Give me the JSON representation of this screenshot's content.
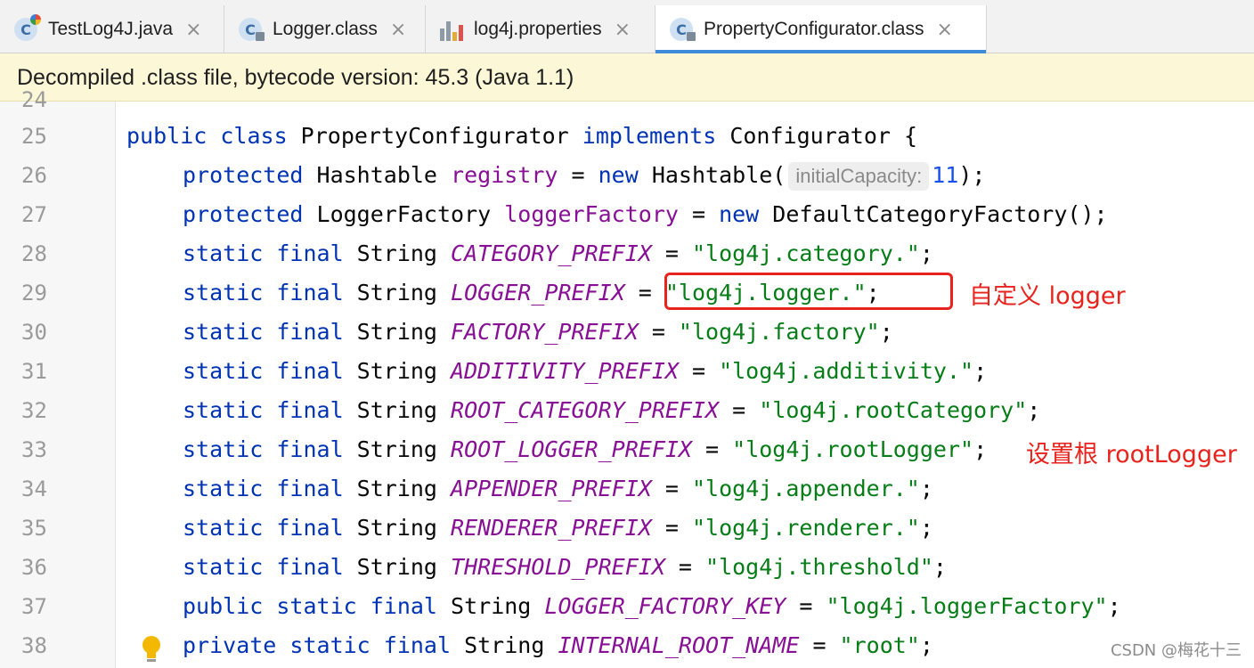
{
  "tabs": [
    {
      "label": "TestLog4J.java",
      "icon": "java-class-run-icon",
      "active": false
    },
    {
      "label": "Logger.class",
      "icon": "class-file-icon",
      "active": false
    },
    {
      "label": "log4j.properties",
      "icon": "properties-file-icon",
      "active": false
    },
    {
      "label": "PropertyConfigurator.class",
      "icon": "class-file-icon",
      "active": true
    }
  ],
  "close_glyph": "×",
  "banner": {
    "text": "Decompiled .class file, bytecode version: 45.3 (Java 1.1)"
  },
  "editor": {
    "line_numbers": [
      "25",
      "26",
      "27",
      "28",
      "29",
      "30",
      "31",
      "32",
      "33",
      "34",
      "35",
      "36",
      "37",
      "38"
    ],
    "hint_label": "initialCapacity:",
    "lines": [
      [
        {
          "t": "public class",
          "c": "kw"
        },
        {
          "t": " PropertyConfigurator "
        },
        {
          "t": "implements",
          "c": "kw"
        },
        {
          "t": " Configurator {"
        }
      ],
      [
        {
          "t": "protected",
          "c": "kw"
        },
        {
          "t": " Hashtable "
        },
        {
          "t": "registry",
          "c": "fld"
        },
        {
          "t": " = "
        },
        {
          "t": "new",
          "c": "kw"
        },
        {
          "t": " Hashtable("
        },
        {
          "t": "initialCapacity:",
          "c": "hint"
        },
        {
          "t": "11",
          "c": "num"
        },
        {
          "t": ");"
        }
      ],
      [
        {
          "t": "protected",
          "c": "kw"
        },
        {
          "t": " LoggerFactory "
        },
        {
          "t": "loggerFactory",
          "c": "fld"
        },
        {
          "t": " = "
        },
        {
          "t": "new",
          "c": "kw"
        },
        {
          "t": " DefaultCategoryFactory();"
        }
      ],
      [
        {
          "t": "static final",
          "c": "kw"
        },
        {
          "t": " String "
        },
        {
          "t": "CATEGORY_PREFIX",
          "c": "cst"
        },
        {
          "t": " = "
        },
        {
          "t": "\"log4j.category.\"",
          "c": "str"
        },
        {
          "t": ";"
        }
      ],
      [
        {
          "t": "static final",
          "c": "kw"
        },
        {
          "t": " String "
        },
        {
          "t": "LOGGER_PREFIX",
          "c": "cst"
        },
        {
          "t": " = "
        },
        {
          "t": "\"log4j.logger.\"",
          "c": "str"
        },
        {
          "t": ";"
        }
      ],
      [
        {
          "t": "static final",
          "c": "kw"
        },
        {
          "t": " String "
        },
        {
          "t": "FACTORY_PREFIX",
          "c": "cst"
        },
        {
          "t": " = "
        },
        {
          "t": "\"log4j.factory\"",
          "c": "str"
        },
        {
          "t": ";"
        }
      ],
      [
        {
          "t": "static final",
          "c": "kw"
        },
        {
          "t": " String "
        },
        {
          "t": "ADDITIVITY_PREFIX",
          "c": "cst"
        },
        {
          "t": " = "
        },
        {
          "t": "\"log4j.additivity.\"",
          "c": "str"
        },
        {
          "t": ";"
        }
      ],
      [
        {
          "t": "static final",
          "c": "kw"
        },
        {
          "t": " String "
        },
        {
          "t": "ROOT_CATEGORY_PREFIX",
          "c": "cst"
        },
        {
          "t": " = "
        },
        {
          "t": "\"log4j.rootCategory\"",
          "c": "str"
        },
        {
          "t": ";"
        }
      ],
      [
        {
          "t": "static final",
          "c": "kw"
        },
        {
          "t": " String "
        },
        {
          "t": "ROOT_LOGGER_PREFIX",
          "c": "cst"
        },
        {
          "t": " = "
        },
        {
          "t": "\"log4j.rootLogger\"",
          "c": "str"
        },
        {
          "t": ";"
        }
      ],
      [
        {
          "t": "static final",
          "c": "kw"
        },
        {
          "t": " String "
        },
        {
          "t": "APPENDER_PREFIX",
          "c": "cst"
        },
        {
          "t": " = "
        },
        {
          "t": "\"log4j.appender.\"",
          "c": "str"
        },
        {
          "t": ";"
        }
      ],
      [
        {
          "t": "static final",
          "c": "kw"
        },
        {
          "t": " String "
        },
        {
          "t": "RENDERER_PREFIX",
          "c": "cst"
        },
        {
          "t": " = "
        },
        {
          "t": "\"log4j.renderer.\"",
          "c": "str"
        },
        {
          "t": ";"
        }
      ],
      [
        {
          "t": "static final",
          "c": "kw"
        },
        {
          "t": " String "
        },
        {
          "t": "THRESHOLD_PREFIX",
          "c": "cst"
        },
        {
          "t": " = "
        },
        {
          "t": "\"log4j.threshold\"",
          "c": "str"
        },
        {
          "t": ";"
        }
      ],
      [
        {
          "t": "public static final",
          "c": "kw"
        },
        {
          "t": " String "
        },
        {
          "t": "LOGGER_FACTORY_KEY",
          "c": "cst"
        },
        {
          "t": " = "
        },
        {
          "t": "\"log4j.loggerFactory\"",
          "c": "str"
        },
        {
          "t": ";"
        }
      ],
      [
        {
          "t": "private static final",
          "c": "kw"
        },
        {
          "t": " String "
        },
        {
          "t": "INTERNAL_ROOT_NAME",
          "c": "cst"
        },
        {
          "t": " = "
        },
        {
          "t": "\"root\"",
          "c": "str"
        },
        {
          "t": ";"
        }
      ]
    ]
  },
  "annotations": {
    "logger": "自定义 logger",
    "root_logger": "设置根 rootLogger"
  },
  "watermark": "CSDN @梅花十三",
  "colors": {
    "keyword": "#0033b3",
    "field": "#871094",
    "string": "#067d17",
    "number": "#1750eb",
    "annotation": "#e8231d",
    "tab_underline": "#3d8bd9",
    "banner_bg": "#fcf7d6"
  }
}
